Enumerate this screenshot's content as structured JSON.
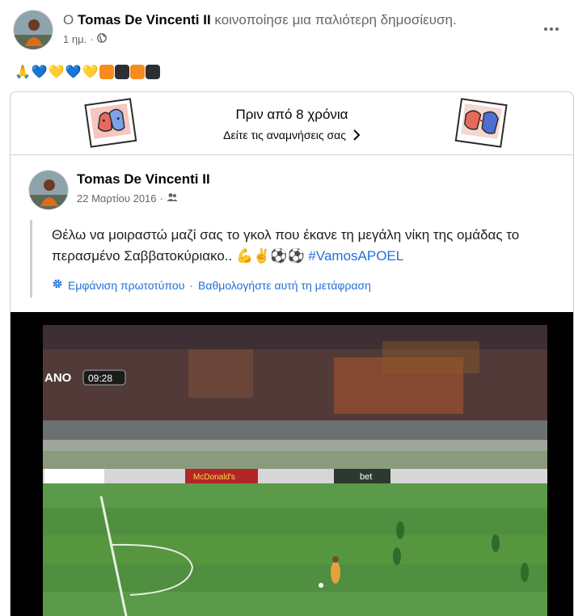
{
  "post": {
    "prefix": "Ο",
    "author": "Tomas De Vincenti II",
    "action": "κοινοποίησε μια παλιότερη δημοσίευση.",
    "time": "1 ημ.",
    "dot": "·",
    "audience_icon": "globe-icon",
    "emojis": [
      "🙏",
      "💙",
      "💛",
      "💙",
      "💛"
    ],
    "squares": [
      "#f68b1e",
      "#2c2f36",
      "#f68b1e",
      "#2c2f36"
    ]
  },
  "memory": {
    "title": "Πριν από 8 χρόνια",
    "link": "Δείτε τις αναμνήσεις σας"
  },
  "inner": {
    "author": "Tomas De Vincenti II",
    "date": "22 Μαρτίου 2016",
    "dot": "·",
    "audience_icon": "friends-icon",
    "text": "Θέλω να μοιραστώ μαζί σας το γκολ που έκανε τη μεγάλη νίκη της ομάδας το περασμένο Σαββατοκύριακο..",
    "text_emojis": "💪✌️⚽⚽",
    "hashtag": "#VamosAPOEL",
    "see_original": "Εμφάνιση πρωτοτύπου",
    "rate_translation": "Βαθμολογήστε αυτή τη μετάφραση",
    "sep": "·"
  },
  "video": {
    "clock": "09:28",
    "board_left": "ANO",
    "board_mid": "McDonald's",
    "board_right": "bet"
  },
  "colors": {
    "link_blue": "#216fdb",
    "secondary": "#65676b",
    "pitch": "#4a8a3c"
  }
}
